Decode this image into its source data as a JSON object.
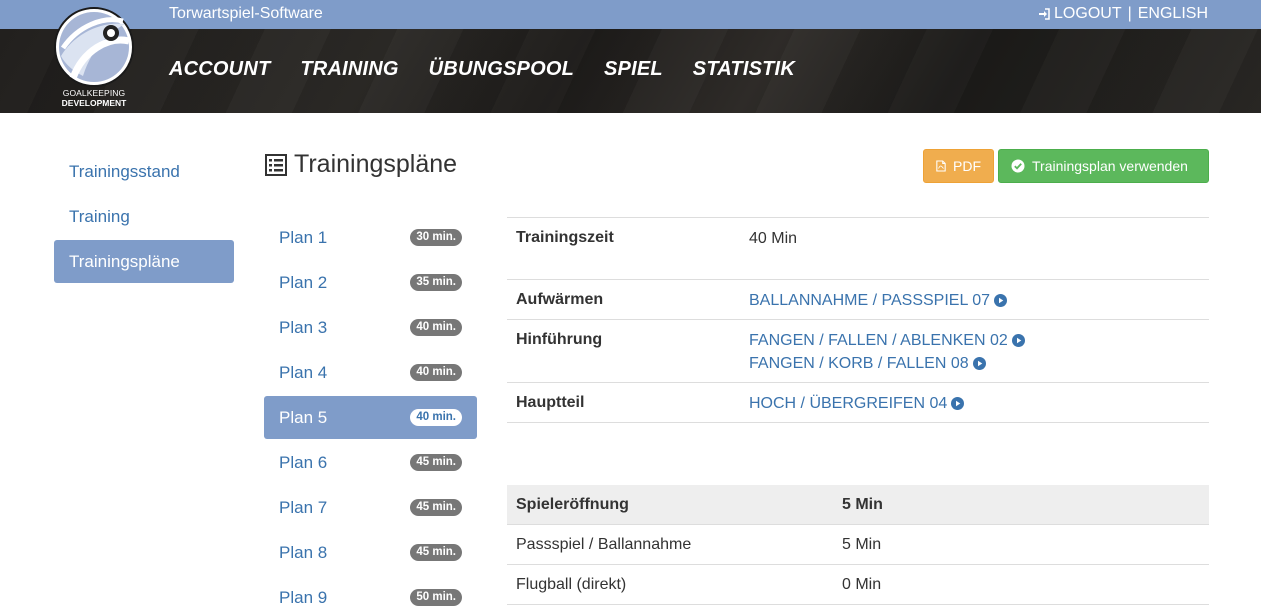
{
  "header": {
    "app_title": "Torwartspiel-Software",
    "logout_label": "LOGOUT",
    "separator": "|",
    "language_label": "ENGLISH",
    "logo_line1": "GOALKEEPING",
    "logo_line2": "DEVELOPMENT"
  },
  "nav": {
    "items": [
      "ACCOUNT",
      "TRAINING",
      "ÜBUNGSPOOL",
      "SPIEL",
      "STATISTIK"
    ]
  },
  "sidebar": {
    "items": [
      "Trainingsstand",
      "Training",
      "Trainingspläne"
    ],
    "active_index": 2
  },
  "page": {
    "title": "Trainingspläne",
    "pdf_button": "PDF",
    "use_button": "Trainingsplan verwenden"
  },
  "plans": [
    {
      "label": "Plan 1",
      "duration": "30 min."
    },
    {
      "label": "Plan 2",
      "duration": "35 min."
    },
    {
      "label": "Plan 3",
      "duration": "40 min."
    },
    {
      "label": "Plan 4",
      "duration": "40 min."
    },
    {
      "label": "Plan 5",
      "duration": "40 min."
    },
    {
      "label": "Plan 6",
      "duration": "45 min."
    },
    {
      "label": "Plan 7",
      "duration": "45 min."
    },
    {
      "label": "Plan 8",
      "duration": "45 min."
    },
    {
      "label": "Plan 9",
      "duration": "50 min."
    }
  ],
  "details": {
    "trainingszeit_label": "Trainingszeit",
    "trainingszeit_value": "40 Min",
    "aufwaermen_label": "Aufwärmen",
    "aufwaermen_links": [
      "BALLANNAHME / PASSSPIEL 07"
    ],
    "hinfuehrung_label": "Hinführung",
    "hinfuehrung_links": [
      "FANGEN / FALLEN / ABLENKEN 02",
      "FANGEN / KORB / FALLEN 08"
    ],
    "hauptteil_label": "Hauptteil",
    "hauptteil_links": [
      "HOCH / ÜBERGREIFEN 04"
    ]
  },
  "summary": {
    "header_label": "Spieleröffnung",
    "header_value": "5 Min",
    "rows": [
      {
        "label": "Passspiel / Ballannahme",
        "value": "5 Min"
      },
      {
        "label": "Flugball (direkt)",
        "value": "0 Min"
      }
    ]
  },
  "colors": {
    "topbar": "#7f9cc9",
    "link": "#3a73ad",
    "pdf_button": "#f0ad4e",
    "use_button": "#5cb85c",
    "badge": "#777777"
  }
}
